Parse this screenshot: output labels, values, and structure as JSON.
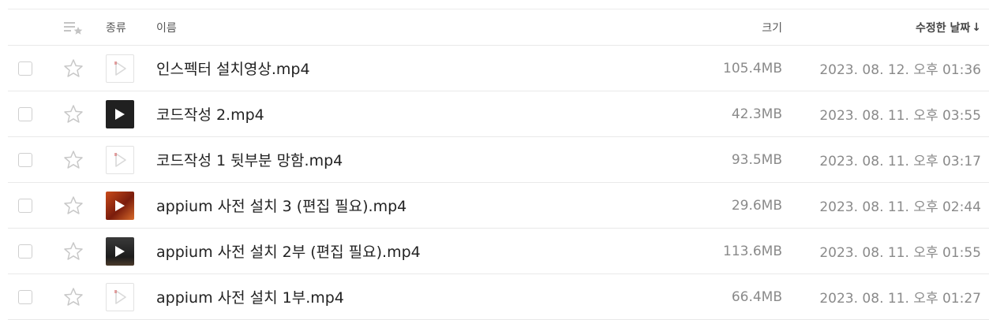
{
  "header": {
    "type_label": "종류",
    "name_label": "이름",
    "size_label": "크기",
    "date_label": "수정한 날짜",
    "sort_arrow": "↓"
  },
  "files": [
    {
      "name": "인스펙터 설치영상.mp4",
      "size": "105.4MB",
      "modified": "2023. 08. 12. 오후 01:36",
      "thumb": "blank-video"
    },
    {
      "name": "코드작성 2.mp4",
      "size": "42.3MB",
      "modified": "2023. 08. 11. 오후 03:55",
      "thumb": "dark-play"
    },
    {
      "name": "코드작성 1 뒷부분 망함.mp4",
      "size": "93.5MB",
      "modified": "2023. 08. 11. 오후 03:17",
      "thumb": "blank-video"
    },
    {
      "name": "appium 사전 설치 3 (편집 필요).mp4",
      "size": "29.6MB",
      "modified": "2023. 08. 11. 오후 02:44",
      "thumb": "orange-play"
    },
    {
      "name": "appium 사전 설치 2부 (편집 필요).mp4",
      "size": "113.6MB",
      "modified": "2023. 08. 11. 오후 01:55",
      "thumb": "screen-play"
    },
    {
      "name": "appium 사전 설치 1부.mp4",
      "size": "66.4MB",
      "modified": "2023. 08. 11. 오후 01:27",
      "thumb": "blank-video"
    }
  ]
}
